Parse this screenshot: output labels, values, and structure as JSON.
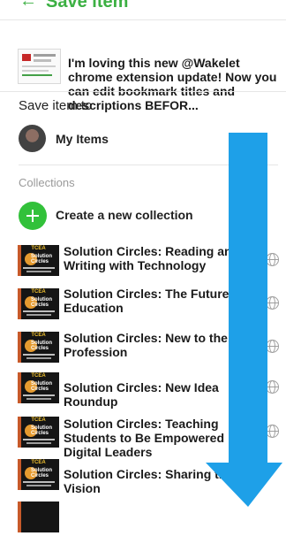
{
  "header": {
    "back_glyph": "←",
    "title": "Save item"
  },
  "preview": {
    "text": "I'm loving this new @Wakelet chrome extension update! Now you can edit bookmark titles and descriptions BEFOR..."
  },
  "save_to_label": "Save item to",
  "my_items": {
    "label": "My Items"
  },
  "collections_label": "Collections",
  "create": {
    "label": "Create a new collection",
    "accent": "#32c13a"
  },
  "thumb_text": {
    "brand": "TCEA",
    "logo_line1": "Solution",
    "logo_line2": "Circles"
  },
  "collections": [
    {
      "title": "Solution Circles: Reading and Writing with Technology"
    },
    {
      "title": "Solution Circles: The Future of Education"
    },
    {
      "title": "Solution Circles: New to the Profession"
    },
    {
      "title": "Solution Circles: New Idea Roundup"
    },
    {
      "title": "Solution Circles: Teaching Students to Be Empowered Digital Leaders"
    },
    {
      "title": "Solution Circles: Sharing the Vision"
    }
  ],
  "overlay": {
    "arrow_color": "#1ea0e8"
  }
}
